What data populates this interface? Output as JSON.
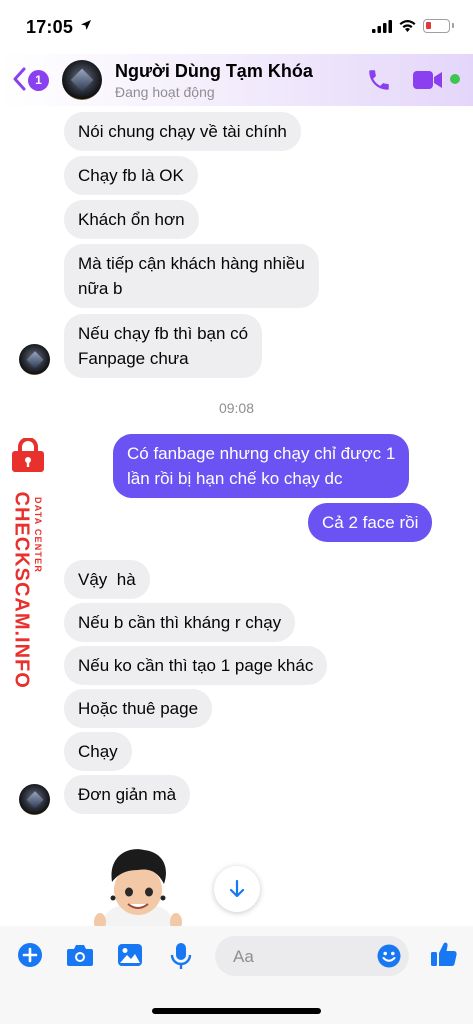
{
  "status": {
    "time": "17:05"
  },
  "header": {
    "back_count": "1",
    "name": "Người Dùng Tạm Khóa",
    "subtitle": "Đang hoạt động"
  },
  "watermark": {
    "small": "DATA CENTER",
    "big": "CHECKSCAM.INFO"
  },
  "messages": [
    {
      "text": "Nói chung chạy về tài chính"
    },
    {
      "text": "Chạy fb là OK"
    },
    {
      "text": "Khách ổn hơn"
    },
    {
      "text": "Mà tiếp cận khách hàng nhiều",
      "text2": "nữa b"
    },
    {
      "text": "Nếu chạy fb thì bạn có",
      "text2": "Fanpage chưa"
    },
    {
      "text": "Có fanbage nhưng chạy chỉ được 1",
      "text2": "lần rồi bị hạn chế ko chạy dc"
    },
    {
      "text": "Cả 2 face rồi"
    },
    {
      "text": "Vậy  hà"
    },
    {
      "text": "Nếu b cần thì kháng r chạy"
    },
    {
      "text": "Nếu ko cần thì tạo 1 page khác"
    },
    {
      "text": "Hoặc thuê page"
    },
    {
      "text": "Chạy"
    },
    {
      "text": "Đơn giản mà"
    }
  ],
  "timestamp": "09:08",
  "composer": {
    "placeholder": "Aa"
  },
  "colors": {
    "accent": "#8a3ff0",
    "outgoing": "#6a53f2",
    "icon_blue": "#1877f2",
    "incoming": "#eeeef1"
  }
}
